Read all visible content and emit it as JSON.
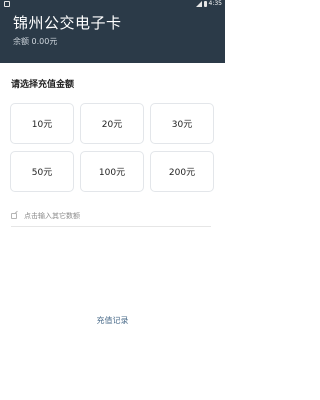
{
  "status_bar": {
    "time": "4:35"
  },
  "header": {
    "title": "锦州公交电子卡",
    "balance_label": "余额",
    "balance_value": "0.00元"
  },
  "recharge": {
    "section_title": "请选择充值金额",
    "amounts": [
      "10元",
      "20元",
      "30元",
      "50元",
      "100元",
      "200元"
    ],
    "custom_placeholder": "点击输入其它数额"
  },
  "footer": {
    "records_link": "充值记录"
  },
  "colors": {
    "header_bg": "#2b3a48",
    "card_border": "#e3e6ea",
    "link": "#4a6b8a"
  }
}
